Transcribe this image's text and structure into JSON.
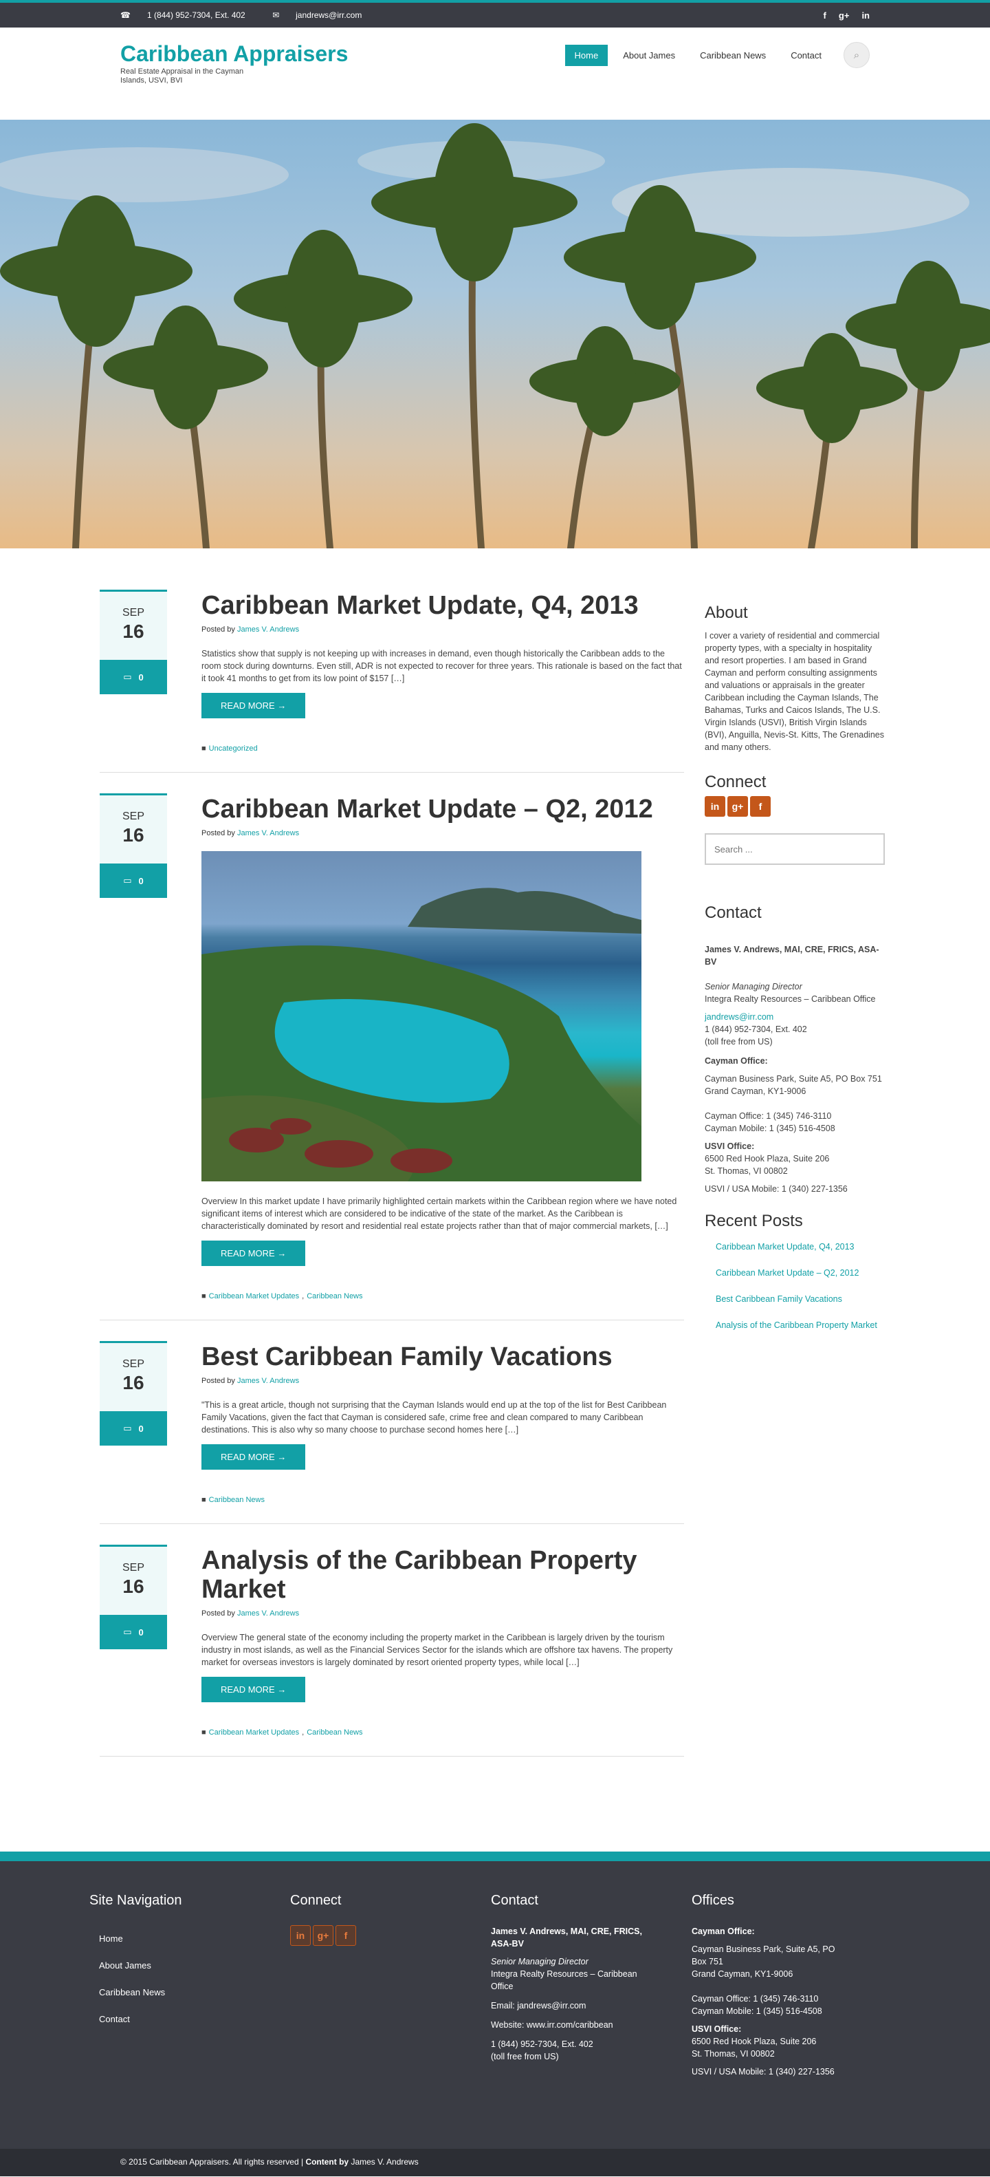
{
  "topbar": {
    "phone": "1 (844) 952-7304, Ext. 402",
    "email": "jandrews@irr.com",
    "social": [
      "f",
      "g+",
      "in"
    ]
  },
  "site": {
    "title": "Caribbean Appraisers",
    "tagline": "Real Estate Appraisal in the Cayman Islands, USVI, BVI"
  },
  "nav": {
    "items": [
      "Home",
      "About James",
      "Caribbean News",
      "Contact"
    ],
    "active": "Home"
  },
  "posts": [
    {
      "month": "SEP",
      "day": "16",
      "comments": "0",
      "title": "Caribbean Market Update, Q4, 2013",
      "posted_prefix": "Posted by",
      "author": "James V. Andrews",
      "excerpt": "Statistics show that supply is not keeping up with increases in demand, even though historically the Caribbean adds to the room stock during downturns. Even still, ADR is not expected to recover for three years. This rationale is based on the fact that it took 41 months to get from its low point of $157 […]",
      "readmore": "READ MORE →",
      "categories": [
        "Uncategorized"
      ]
    },
    {
      "month": "SEP",
      "day": "16",
      "comments": "0",
      "title": "Caribbean Market Update – Q2, 2012",
      "posted_prefix": "Posted by",
      "author": "James V. Andrews",
      "excerpt": "Overview In this market update I have primarily highlighted certain markets within the Caribbean region where we have noted significant items of interest which are considered to be indicative of the state of the market. As the Caribbean is characteristically dominated by resort and residential real estate projects rather than that of major commercial markets, […]",
      "readmore": "READ MORE →",
      "categories": [
        "Caribbean Market Updates",
        "Caribbean News"
      ]
    },
    {
      "month": "SEP",
      "day": "16",
      "comments": "0",
      "title": "Best Caribbean Family Vacations",
      "posted_prefix": "Posted by",
      "author": "James V. Andrews",
      "excerpt": "\"This is a great article, though not surprising that the Cayman Islands would end up at the top of the list for Best Caribbean Family Vacations, given the fact that Cayman is considered safe, crime free and clean compared to many Caribbean destinations. This is also why so many choose to purchase second homes here […]",
      "readmore": "READ MORE →",
      "categories": [
        "Caribbean News"
      ]
    },
    {
      "month": "SEP",
      "day": "16",
      "comments": "0",
      "title": "Analysis of the Caribbean Property Market",
      "posted_prefix": "Posted by",
      "author": "James V. Andrews",
      "excerpt": "Overview The general state of the economy including the property market in the Caribbean is largely driven by the tourism industry in most islands, as well as the Financial Services Sector for the islands which are offshore tax havens. The property market for overseas investors is largely dominated by resort oriented property types, while local […]",
      "readmore": "READ MORE →",
      "categories": [
        "Caribbean Market Updates",
        "Caribbean News"
      ]
    }
  ],
  "sidebar": {
    "about_title": "About",
    "about_text": "I cover a variety of residential and commercial property types, with a specialty in hospitality and resort properties. I am based in Grand Cayman and perform consulting assignments and valuations or appraisals in the greater Caribbean including the Cayman Islands, The Bahamas, Turks and Caicos Islands, The U.S. Virgin Islands (USVI), British Virgin Islands (BVI), Anguilla, Nevis-St. Kitts, The Grenadines and many others.",
    "connect_title": "Connect",
    "social": [
      "in",
      "g+",
      "f"
    ],
    "search_placeholder": "Search ...",
    "contact_title": "Contact",
    "contact_name": "James V. Andrews, MAI, CRE, FRICS, ASA-BV",
    "contact_role": "Senior Managing Director",
    "contact_company": "Integra Realty Resources – Caribbean Office",
    "contact_email": "jandrews@irr.com",
    "contact_phone": "1 (844) 952-7304, Ext. 402",
    "contact_tollfree": "(toll free from US)",
    "cayman_label": "Cayman Office:",
    "cayman_addr1": "Cayman Business Park, Suite A5, PO Box 751",
    "cayman_addr2": "Grand Cayman, KY1-9006",
    "cayman_office_phone": "Cayman Office: 1 (345) 746-3110",
    "cayman_mobile": "Cayman Mobile:  1 (345) 516-4508",
    "usvi_label": "USVI Office:",
    "usvi_addr1": "6500 Red Hook Plaza, Suite 206",
    "usvi_addr2": "St. Thomas, VI 00802",
    "usvi_mobile": "USVI / USA Mobile: 1 (340) 227-1356",
    "recent_title": "Recent Posts",
    "recent": [
      "Caribbean Market Update, Q4, 2013",
      "Caribbean Market Update – Q2, 2012",
      "Best Caribbean Family Vacations",
      "Analysis of the Caribbean Property Market"
    ]
  },
  "footer": {
    "nav_title": "Site Navigation",
    "nav_items": [
      "Home",
      "About James",
      "Caribbean News",
      "Contact"
    ],
    "connect_title": "Connect",
    "social": [
      "in",
      "g+",
      "f"
    ],
    "contact_title": "Contact",
    "contact_name": "James V. Andrews, MAI, CRE, FRICS, ASA-BV",
    "contact_role": "Senior Managing Director",
    "contact_company": "Integra Realty Resources – Caribbean Office",
    "contact_email": "Email: jandrews@irr.com",
    "contact_website": "Website: www.irr.com/caribbean",
    "contact_phone": "1 (844) 952-7304, Ext. 402",
    "contact_tollfree": "(toll free from US)",
    "offices_title": "Offices",
    "cayman_label": "Cayman Office:",
    "cayman_addr1": "Cayman Business Park, Suite A5, PO Box 751",
    "cayman_addr2": "Grand Cayman, KY1-9006",
    "cayman_office_phone": "Cayman Office: 1 (345) 746-3110",
    "cayman_mobile": "Cayman Mobile:  1 (345) 516-4508",
    "usvi_label": "USVI Office:",
    "usvi_addr1": "6500 Red Hook Plaza, Suite 206",
    "usvi_addr2": "St. Thomas, VI 00802",
    "usvi_mobile": "USVI / USA Mobile: 1 (340) 227-1356"
  },
  "copyright": {
    "text": "© 2015 Caribbean Appraisers. All rights reserved | ",
    "content_by_label": "Content by",
    "content_by": " James V. Andrews"
  }
}
